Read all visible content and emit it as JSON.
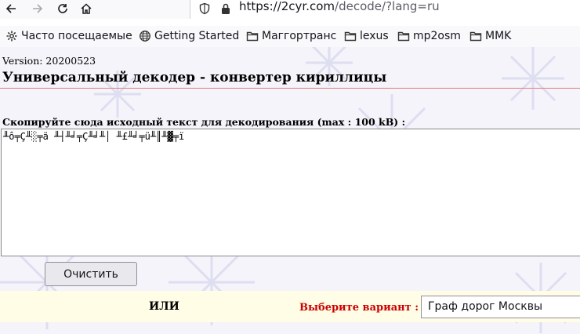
{
  "browser": {
    "url_host": "https://2cyr.com",
    "url_path": "/decode/?lang=ru"
  },
  "bookmarks": [
    {
      "label": "Часто посещаемые",
      "icon": "gear-icon"
    },
    {
      "label": "Getting Started",
      "icon": "globe-icon"
    },
    {
      "label": "Маггортранс",
      "icon": "folder-icon"
    },
    {
      "label": "lexus",
      "icon": "folder-icon"
    },
    {
      "label": "mp2osm",
      "icon": "folder-icon"
    },
    {
      "label": "MMK",
      "icon": "folder-icon"
    }
  ],
  "page": {
    "version": "Version: 20200523",
    "title": "Универсальный декодер - конвертер кириллицы",
    "prompt": "Скопируйте сюда исходный текст для декодирования (max : 100 kB) :",
    "source_text": "╨ô╤Ç╨░╤ä ╨┤╨╛╤Ç╨╛╨│ ╨£╨╛╤ü╨║╨▓╤ï",
    "clear_button": "Очистить",
    "or_label": "ИЛИ",
    "choose_label": "Выберите вариант :",
    "variant_value": "Граф дорог Москвы"
  }
}
